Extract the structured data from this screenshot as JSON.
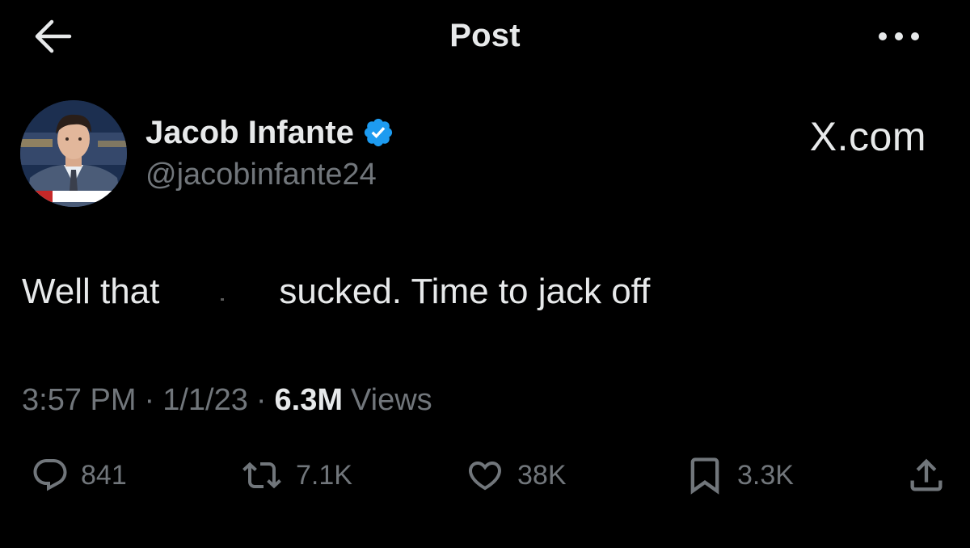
{
  "header": {
    "title": "Post",
    "back_icon": "arrow-left-icon",
    "more_icon": "more-dots-icon"
  },
  "author": {
    "name": "Jacob Infante",
    "handle": "@jacobinfante24",
    "verified": true,
    "verified_color": "#1d9bf0"
  },
  "watermark": "X.com",
  "post": {
    "text_before": "Well that",
    "text_after": "sucked. Time to jack off"
  },
  "meta": {
    "time": "3:57 PM",
    "separator": "·",
    "date": "1/1/23",
    "views_count": "6.3M",
    "views_label": "Views"
  },
  "actions": {
    "replies": "841",
    "reposts": "7.1K",
    "likes": "38K",
    "bookmarks": "3.3K"
  },
  "colors": {
    "background": "#000000",
    "text_primary": "#e7e9ea",
    "text_secondary": "#71767b",
    "accent": "#1d9bf0"
  }
}
